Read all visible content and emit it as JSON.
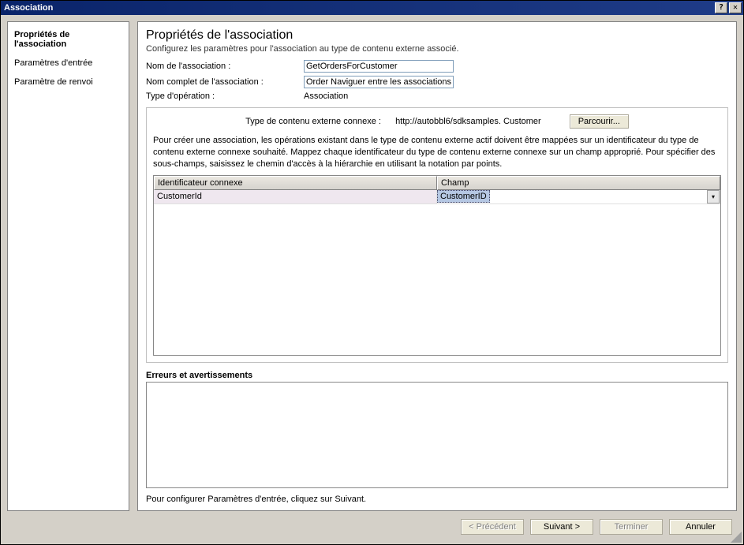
{
  "titlebar": {
    "title": "Association"
  },
  "sidebar": {
    "items": [
      {
        "label": "Propriétés de l'association",
        "active": true
      },
      {
        "label": "Paramètres d'entrée",
        "active": false
      },
      {
        "label": "Paramètre de renvoi",
        "active": false
      }
    ]
  },
  "page": {
    "title": "Propriétés de l'association",
    "description": "Configurez les paramètres pour l'association au type de contenu externe associé."
  },
  "form": {
    "name_label": "Nom de l'association :",
    "name_value": "GetOrdersForCustomer",
    "fullname_label": "Nom complet de l'association :",
    "fullname_value": "Order Naviguer entre les associations",
    "optype_label": "Type d'opération :",
    "optype_value": "Association"
  },
  "panel": {
    "related_label": "Type de contenu externe connexe :",
    "related_value": "http://autobbl6/sdksamples. Customer",
    "browse_label": "Parcourir...",
    "help_text": "Pour créer une association, les opérations existant dans le type de contenu externe actif doivent être mappées sur un identificateur du type de contenu externe connexe souhaité. Mappez chaque identificateur du type de contenu externe connexe sur un champ approprié. Pour spécifier des sous-champs, saisissez le chemin d'accès à la hiérarchie en utilisant la notation par points.",
    "grid": {
      "columns": [
        "Identificateur connexe",
        "Champ"
      ],
      "rows": [
        {
          "id": "CustomerId",
          "field": "CustomerID"
        }
      ]
    }
  },
  "errors": {
    "label": "Erreurs et avertissements"
  },
  "hint": "Pour configurer Paramètres d'entrée, cliquez sur Suivant.",
  "footer": {
    "prev": "< Précédent",
    "next": "Suivant >",
    "finish": "Terminer",
    "cancel": "Annuler"
  }
}
